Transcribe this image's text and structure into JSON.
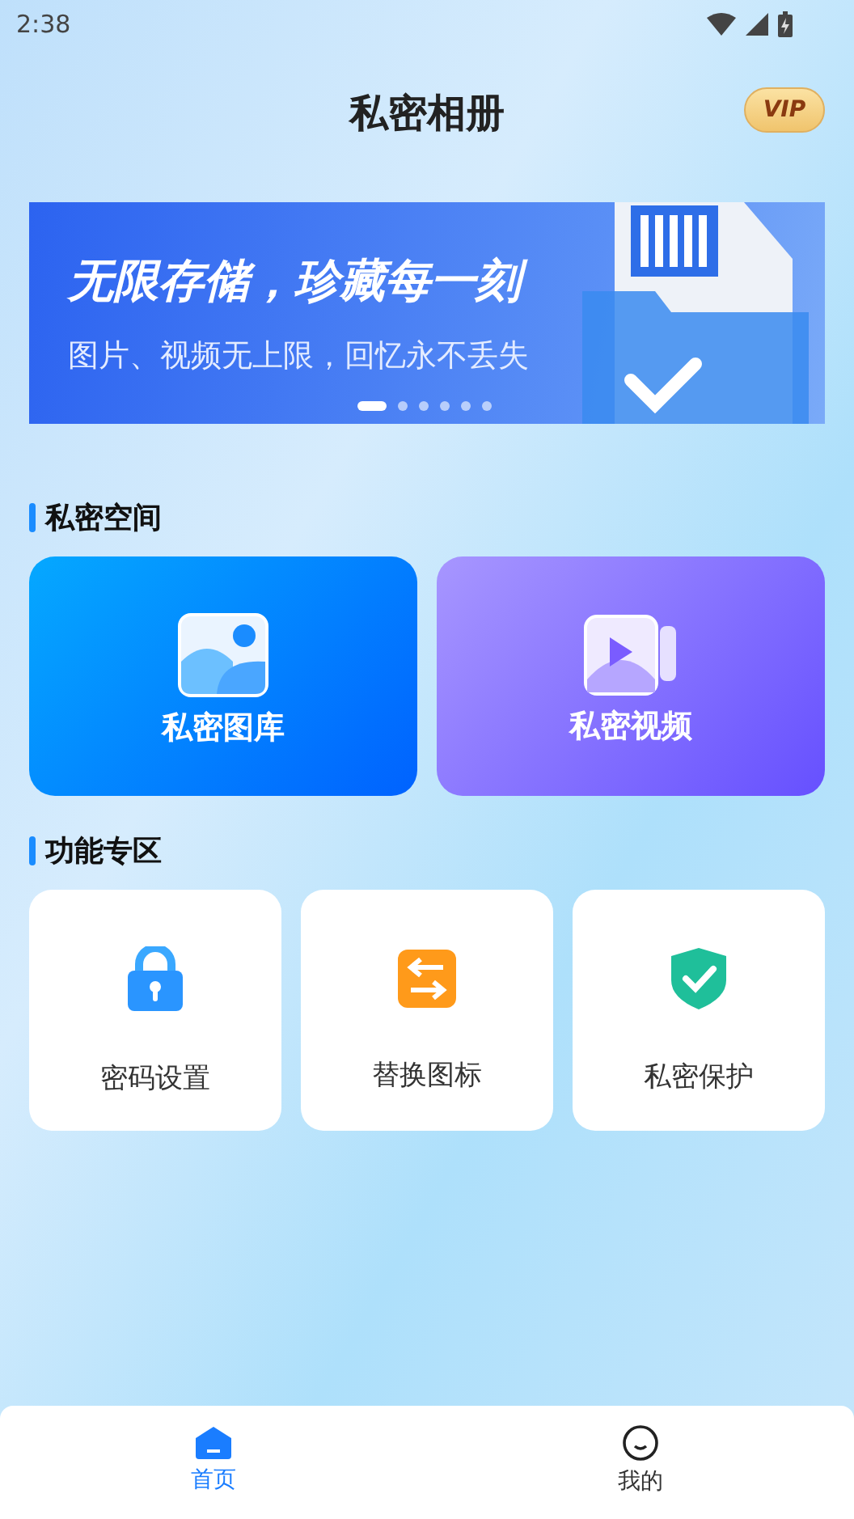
{
  "status_bar": {
    "time": "2:38"
  },
  "header": {
    "title": "私密相册",
    "badge": "VIP"
  },
  "banner": {
    "headline": "无限存储，珍藏每一刻",
    "subtitle": "图片、视频无上限，回忆永不丢失",
    "dots": [
      {
        "selected": true
      },
      {
        "selected": false
      },
      {
        "selected": false
      },
      {
        "selected": false
      },
      {
        "selected": false
      },
      {
        "selected": false
      }
    ]
  },
  "private_space": {
    "heading": "私密空间",
    "cards": [
      {
        "kind": "gallery",
        "label": "私密图库"
      },
      {
        "kind": "video",
        "label": "私密视频"
      }
    ]
  },
  "features": {
    "heading": "功能专区",
    "items": [
      {
        "kind": "lock",
        "label": "密码设置"
      },
      {
        "kind": "swap",
        "label": "替换图标"
      },
      {
        "kind": "shield",
        "label": "私密保护"
      }
    ]
  },
  "tab_bar": [
    {
      "kind": "home",
      "label": "首页",
      "selected": true
    },
    {
      "kind": "profile",
      "label": "我的",
      "selected": false
    }
  ]
}
